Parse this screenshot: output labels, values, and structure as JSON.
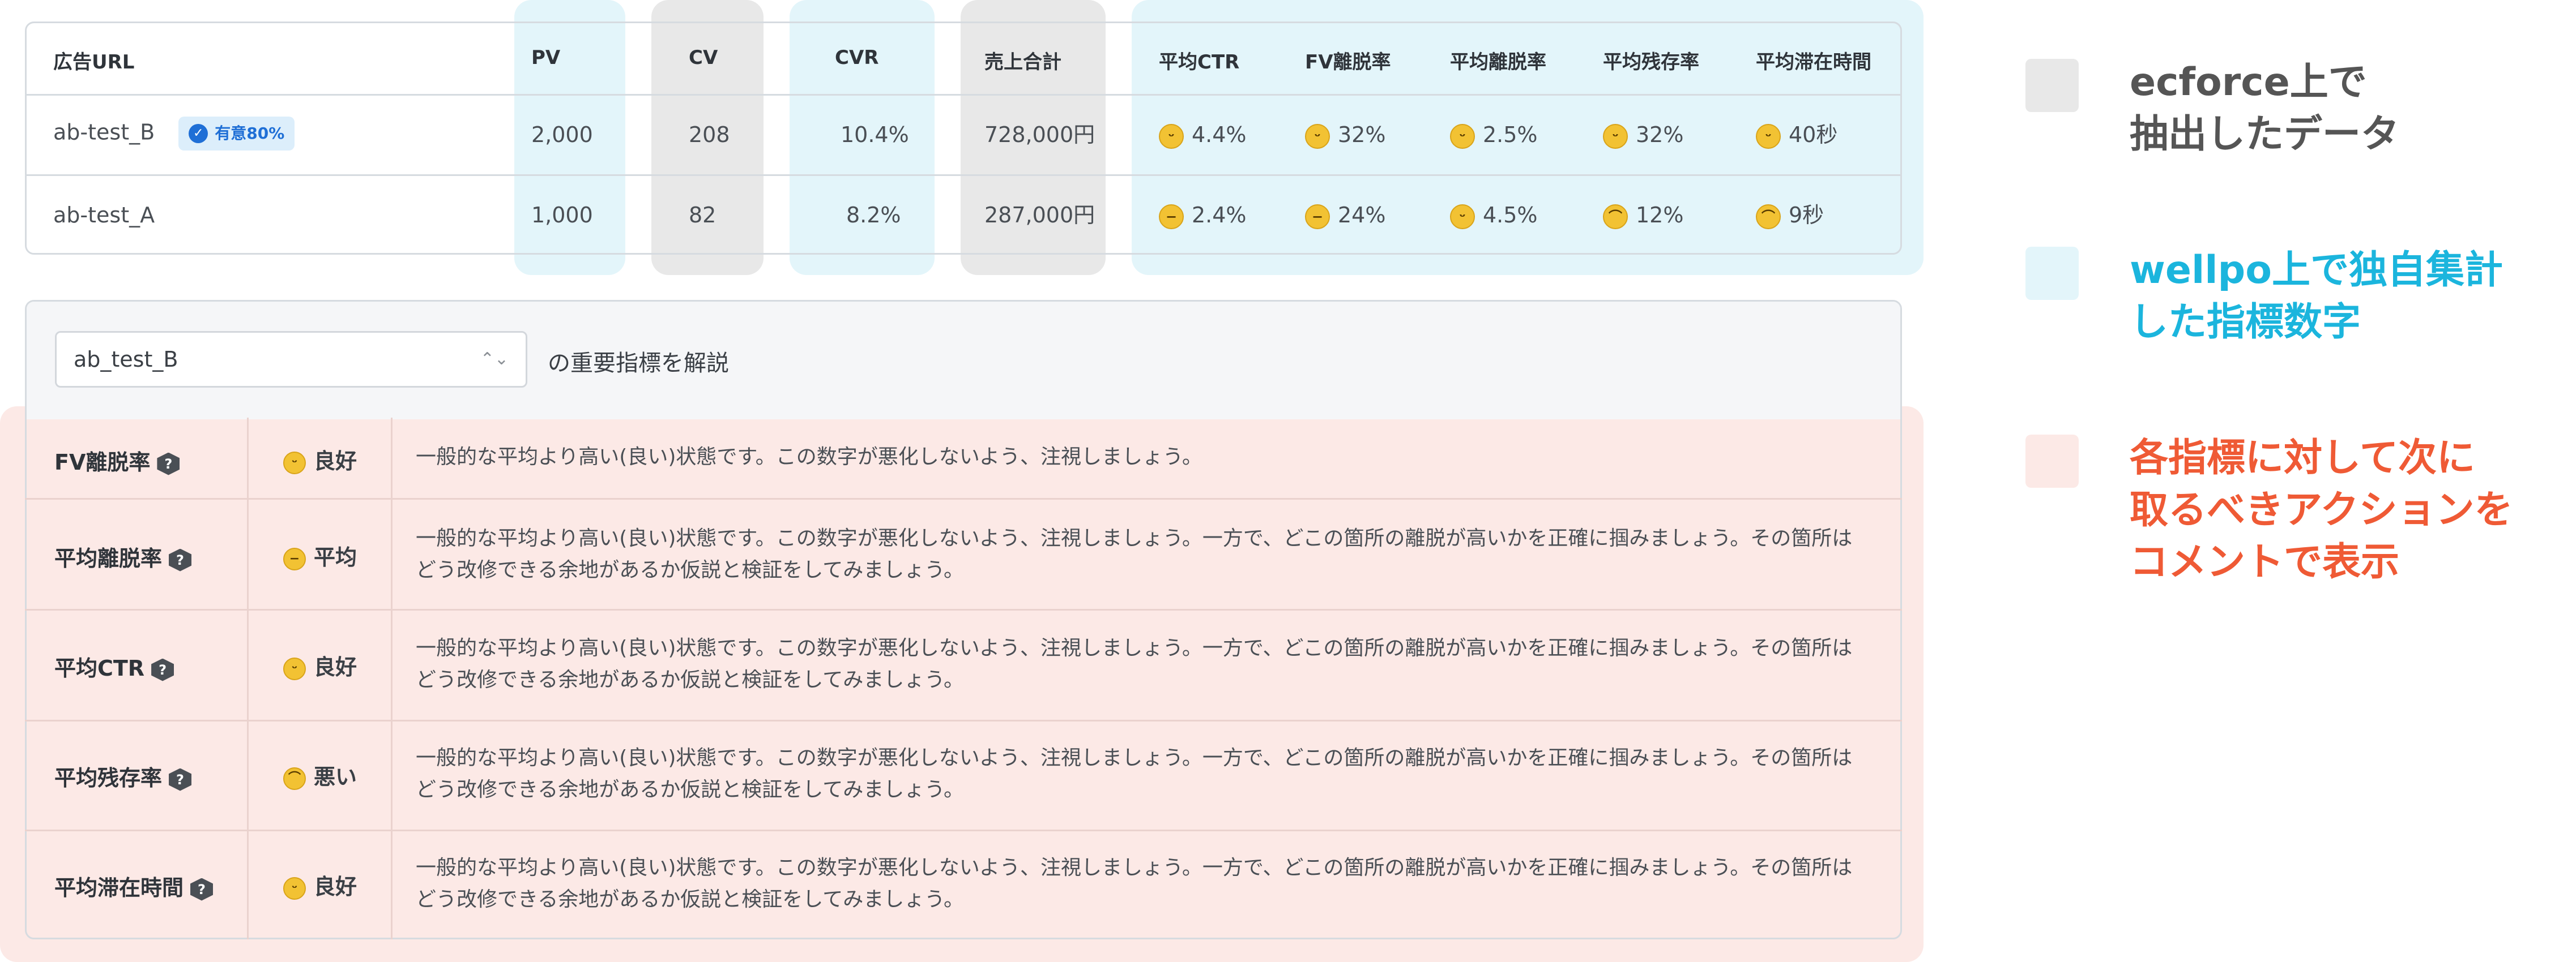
{
  "metrics_table": {
    "headers": {
      "url": "広告URL",
      "pv": "PV",
      "cv": "CV",
      "cvr": "CVR",
      "sales": "売上合計",
      "ctr": "平均CTR",
      "fv": "FV離脱率",
      "exit": "平均離脱率",
      "remain": "平均残存率",
      "stay": "平均滞在時間"
    },
    "rows": [
      {
        "url": "ab-test_B",
        "badge": "有意80%",
        "pv": "2,000",
        "cv": "208",
        "cvr": "10.4%",
        "sales": "728,000円",
        "ctr": {
          "face": "smile",
          "value": "4.4%"
        },
        "fv": {
          "face": "smile",
          "value": "32%"
        },
        "exit": {
          "face": "smile",
          "value": "2.5%"
        },
        "remain": {
          "face": "smile",
          "value": "32%"
        },
        "stay": {
          "face": "smile",
          "value": "40秒"
        }
      },
      {
        "url": "ab-test_A",
        "pv": "1,000",
        "cv": "82",
        "cvr": "8.2%",
        "sales": "287,000円",
        "ctr": {
          "face": "neutral",
          "value": "2.4%"
        },
        "fv": {
          "face": "neutral",
          "value": "24%"
        },
        "exit": {
          "face": "smile",
          "value": "4.5%"
        },
        "remain": {
          "face": "frown",
          "value": "12%"
        },
        "stay": {
          "face": "frown",
          "value": "9秒"
        }
      }
    ]
  },
  "explanation": {
    "selected_ad": "ab_test_B",
    "caption": "の重要指標を解説",
    "rows": [
      {
        "metric": "FV離脱率",
        "face": "smile",
        "rating": "良好",
        "comment": "一般的な平均より高い(良い)状態です。この数字が悪化しないよう、注視しましょう。"
      },
      {
        "metric": "平均離脱率",
        "face": "neutral",
        "rating": "平均",
        "comment": "一般的な平均より高い(良い)状態です。この数字が悪化しないよう、注視しましょう。一方で、どこの箇所の離脱が高いかを正確に掴みましょう。その箇所はどう改修できる余地があるか仮説と検証をしてみましょう。"
      },
      {
        "metric": "平均CTR",
        "face": "smile",
        "rating": "良好",
        "comment": "一般的な平均より高い(良い)状態です。この数字が悪化しないよう、注視しましょう。一方で、どこの箇所の離脱が高いかを正確に掴みましょう。その箇所はどう改修できる余地があるか仮説と検証をしてみましょう。"
      },
      {
        "metric": "平均残存率",
        "face": "frown",
        "rating": "悪い",
        "comment": "一般的な平均より高い(良い)状態です。この数字が悪化しないよう、注視しましょう。一方で、どこの箇所の離脱が高いかを正確に掴みましょう。その箇所はどう改修できる余地があるか仮説と検証をしてみましょう。"
      },
      {
        "metric": "平均滞在時間",
        "face": "smile",
        "rating": "良好",
        "comment": "一般的な平均より高い(良い)状態です。この数字が悪化しないよう、注視しましょう。一方で、どこの箇所の離脱が高いかを正確に掴みましょう。その箇所はどう改修できる余地があるか仮説と検証をしてみましょう。"
      }
    ]
  },
  "legend": [
    {
      "text": "ecforce上で\n抽出したデータ",
      "color": "#555555",
      "swatch": "#e8e8e8"
    },
    {
      "text": "wellpo上で独自集計\nした指標数字",
      "color": "#1bb5dd",
      "swatch": "#e3f5fa"
    },
    {
      "text": "各指標に対して次に\n取るべきアクションを\nコメントで表示",
      "color": "#ef5a35",
      "swatch": "#fce9e6"
    }
  ],
  "icons": {
    "smile": "smile-face-icon",
    "neutral": "neutral-face-icon",
    "frown": "frown-face-icon",
    "help": "question-icon",
    "badge": "check-badge-icon",
    "select": "up-down-chevron-icon"
  },
  "colors": {
    "blue_highlight": "#e3f5fa",
    "gray_highlight": "#e8e8e8",
    "pink_highlight": "#fce9e6",
    "badge_blue": "#1f6fd6"
  }
}
